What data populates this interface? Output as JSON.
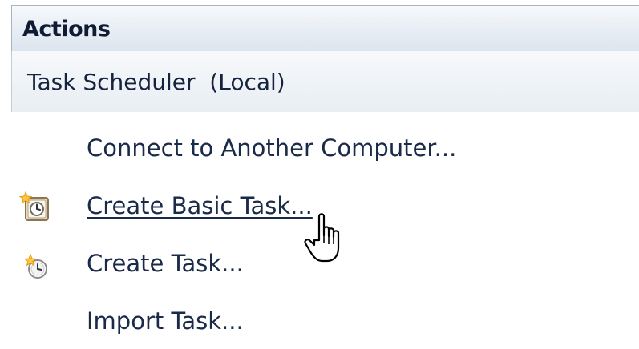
{
  "actions_pane": {
    "header": {
      "title": "Actions"
    },
    "section": {
      "title": "Task Scheduler  (Local)"
    },
    "items": [
      {
        "label": "Connect to Another Computer...",
        "icon": "none"
      },
      {
        "label": "Create Basic Task...",
        "icon": "create-basic-task-icon",
        "state": "hovered"
      },
      {
        "label": "Create Task...",
        "icon": "create-task-icon"
      },
      {
        "label": "Import Task...",
        "icon": "none"
      }
    ]
  },
  "pointer": {
    "icon": "hand-pointer-icon"
  },
  "colors": {
    "header_text": "#0e1b33",
    "item_text": "#1a2a49",
    "header_border": "#a9b4c2",
    "background": "#ffffff"
  }
}
